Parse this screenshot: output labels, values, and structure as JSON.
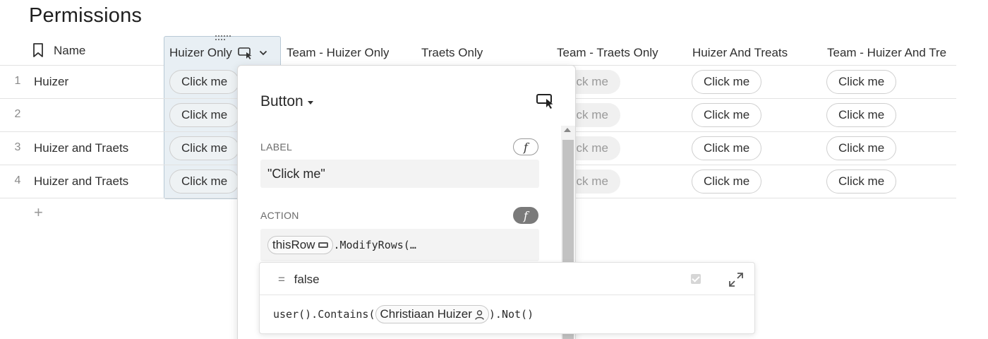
{
  "page": {
    "title": "Permissions"
  },
  "table": {
    "columns": [
      {
        "label": "Name",
        "icon": "bookmark-icon"
      },
      {
        "label": "Huizer Only",
        "icons": [
          "button-column-icon",
          "chevron-down-icon"
        ]
      },
      {
        "label": "Team - Huizer Only"
      },
      {
        "label": "Traets Only"
      },
      {
        "label": "Team - Traets Only"
      },
      {
        "label": "Huizer And Treats"
      },
      {
        "label": "Team - Huizer And Tre"
      }
    ],
    "rows": [
      {
        "num": "1",
        "name": "Huizer"
      },
      {
        "num": "2",
        "name": ""
      },
      {
        "num": "3",
        "name": "Huizer and Traets"
      },
      {
        "num": "4",
        "name": "Huizer and Traets"
      }
    ],
    "button_label": "Click me",
    "faded_button_label": "lick me",
    "add_row_label": "+"
  },
  "popover": {
    "title": "Button",
    "label_section": {
      "heading": "LABEL",
      "formula_icon": "f",
      "value": "\"Click me\""
    },
    "action_section": {
      "heading": "ACTION",
      "formula_icon": "f",
      "token": "thisRow",
      "call": ".ModifyRows(…"
    }
  },
  "formula_panel": {
    "result_prefix": "=",
    "result": "false",
    "formula_start": "user().Contains(",
    "person_token": "Christiaan Huizer",
    "formula_end": ").Not()"
  }
}
